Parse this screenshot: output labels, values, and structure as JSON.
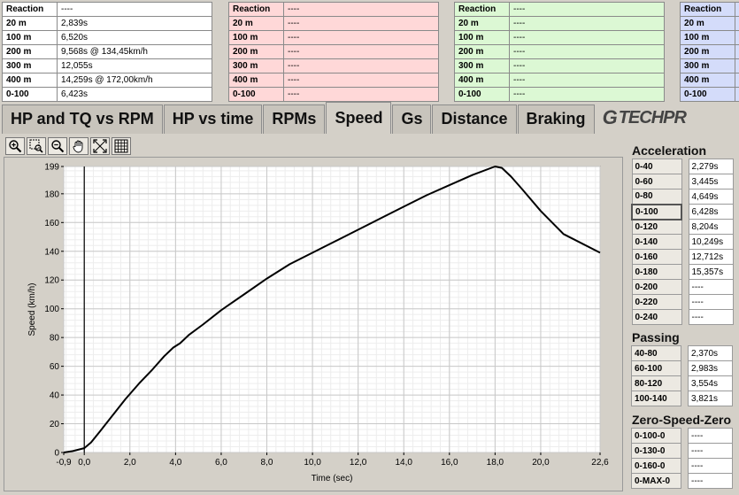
{
  "run_tables": [
    {
      "rows": [
        {
          "label": "Reaction",
          "value": "----"
        },
        {
          "label": "20 m",
          "value": "2,839s"
        },
        {
          "label": "100 m",
          "value": "6,520s"
        },
        {
          "label": "200 m",
          "value": "9,568s @ 134,45km/h"
        },
        {
          "label": "300 m",
          "value": "12,055s"
        },
        {
          "label": "400 m",
          "value": "14,259s @ 172,00km/h"
        },
        {
          "label": "0-100",
          "value": "6,423s"
        }
      ]
    },
    {
      "rows": [
        {
          "label": "Reaction",
          "value": "----"
        },
        {
          "label": "20 m",
          "value": "----"
        },
        {
          "label": "100 m",
          "value": "----"
        },
        {
          "label": "200 m",
          "value": "----"
        },
        {
          "label": "300 m",
          "value": "----"
        },
        {
          "label": "400 m",
          "value": "----"
        },
        {
          "label": "0-100",
          "value": "----"
        }
      ]
    },
    {
      "rows": [
        {
          "label": "Reaction",
          "value": "----"
        },
        {
          "label": "20 m",
          "value": "----"
        },
        {
          "label": "100 m",
          "value": "----"
        },
        {
          "label": "200 m",
          "value": "----"
        },
        {
          "label": "300 m",
          "value": "----"
        },
        {
          "label": "400 m",
          "value": "----"
        },
        {
          "label": "0-100",
          "value": "----"
        }
      ]
    },
    {
      "rows": [
        {
          "label": "Reaction",
          "value": ""
        },
        {
          "label": "20 m",
          "value": ""
        },
        {
          "label": "100 m",
          "value": ""
        },
        {
          "label": "200 m",
          "value": ""
        },
        {
          "label": "300 m",
          "value": ""
        },
        {
          "label": "400 m",
          "value": ""
        },
        {
          "label": "0-100",
          "value": ""
        }
      ]
    }
  ],
  "tabs": [
    "HP and TQ vs RPM",
    "HP vs time",
    "RPMs",
    "Speed",
    "Gs",
    "Distance",
    "Braking"
  ],
  "active_tab": "Speed",
  "logo_text": "TECHPR",
  "toolbar_icons": [
    "zoom-in-icon",
    "zoom-rect-icon",
    "zoom-out-icon",
    "pan-hand-icon",
    "zoom-fit-icon",
    "grid-icon"
  ],
  "acceleration": {
    "title": "Acceleration",
    "rows": [
      {
        "label": "0-40",
        "value": "2,279s"
      },
      {
        "label": "0-60",
        "value": "3,445s"
      },
      {
        "label": "0-80",
        "value": "4,649s"
      },
      {
        "label": "0-100",
        "value": "6,428s"
      },
      {
        "label": "0-120",
        "value": "8,204s"
      },
      {
        "label": "0-140",
        "value": "10,249s"
      },
      {
        "label": "0-160",
        "value": "12,712s"
      },
      {
        "label": "0-180",
        "value": "15,357s"
      },
      {
        "label": "0-200",
        "value": "----"
      },
      {
        "label": "0-220",
        "value": "----"
      },
      {
        "label": "0-240",
        "value": "----"
      }
    ]
  },
  "passing": {
    "title": "Passing",
    "rows": [
      {
        "label": "40-80",
        "value": "2,370s"
      },
      {
        "label": "60-100",
        "value": "2,983s"
      },
      {
        "label": "80-120",
        "value": "3,554s"
      },
      {
        "label": "100-140",
        "value": "3,821s"
      }
    ]
  },
  "zero_speed_zero": {
    "title": "Zero-Speed-Zero",
    "rows": [
      {
        "label": "0-100-0",
        "value": "----"
      },
      {
        "label": "0-130-0",
        "value": "----"
      },
      {
        "label": "0-160-0",
        "value": "----"
      },
      {
        "label": "0-MAX-0",
        "value": "----"
      }
    ]
  },
  "chart_data": {
    "type": "line",
    "xlabel": "Time (sec)",
    "ylabel": "Speed (km/h)",
    "xlim": [
      -0.9,
      22.6
    ],
    "ylim": [
      0,
      199
    ],
    "x_ticks": [
      "-0,9",
      "0,0",
      "2,0",
      "4,0",
      "6,0",
      "8,0",
      "10,0",
      "12,0",
      "14,0",
      "16,0",
      "18,0",
      "20,0",
      "22,6"
    ],
    "x_tick_values": [
      -0.9,
      0,
      2,
      4,
      6,
      8,
      10,
      12,
      14,
      16,
      18,
      20,
      22.6
    ],
    "y_ticks": [
      "0",
      "20",
      "40",
      "60",
      "80",
      "100",
      "120",
      "140",
      "160",
      "180",
      "199"
    ],
    "y_tick_values": [
      0,
      20,
      40,
      60,
      80,
      100,
      120,
      140,
      160,
      180,
      199
    ],
    "grid": true,
    "marker_x": 0,
    "series": [
      {
        "color": "#000000",
        "x": [
          -0.9,
          -0.5,
          0,
          0.3,
          0.7,
          1.2,
          1.8,
          2.4,
          3.0,
          3.5,
          3.9,
          4.2,
          4.6,
          5.2,
          6.0,
          7.0,
          8.0,
          9.0,
          10.0,
          11.0,
          12.0,
          13.0,
          14.0,
          15.0,
          16.0,
          17.0,
          18.0,
          18.3,
          18.7,
          19.2,
          20.0,
          21.0,
          22.6
        ],
        "y": [
          0,
          1,
          3,
          7,
          15,
          25,
          37,
          48,
          58,
          67,
          73,
          76,
          82,
          89,
          99,
          110,
          121,
          131,
          139,
          147,
          155,
          163,
          171,
          179,
          186,
          193,
          199,
          198,
          192,
          183,
          168,
          152,
          139
        ]
      }
    ]
  }
}
